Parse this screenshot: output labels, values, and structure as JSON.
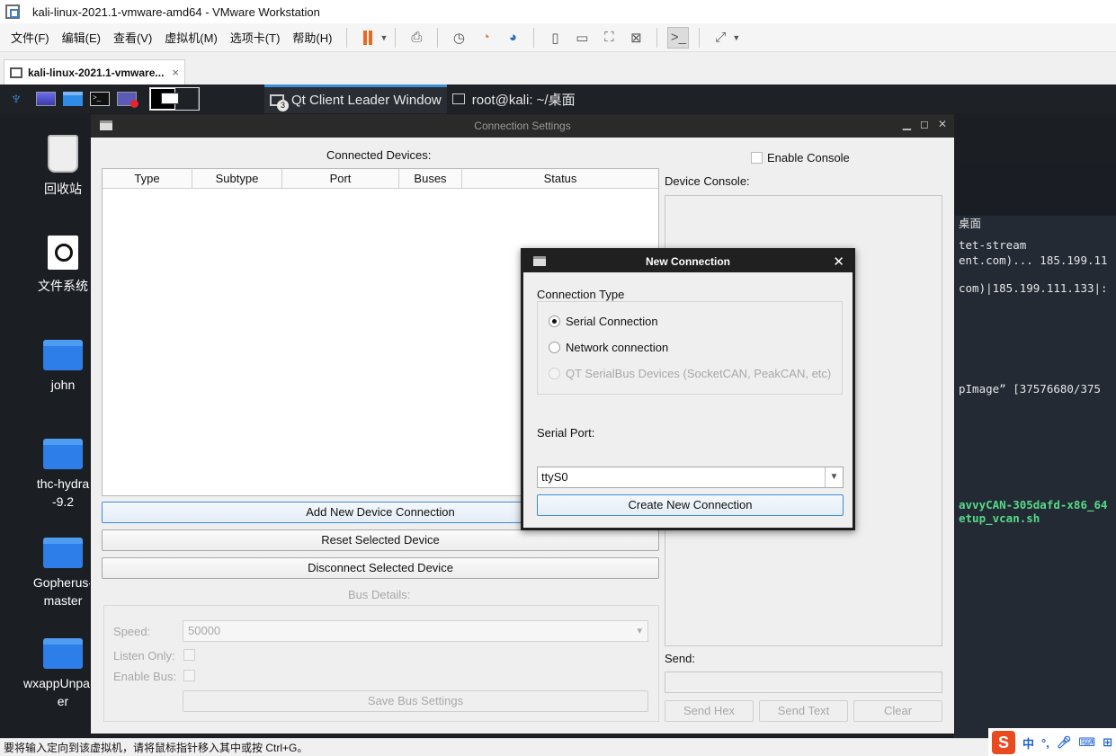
{
  "vmware": {
    "window_title": "kali-linux-2021.1-vmware-amd64 - VMware Workstation",
    "menu": [
      "文件(F)",
      "编辑(E)",
      "查看(V)",
      "虚拟机(M)",
      "选项卡(T)",
      "帮助(H)"
    ],
    "tab_label": "kali-linux-2021.1-vmware...",
    "tab_close": "×",
    "status_message": "要将输入定向到该虚拟机，请将鼠标指针移入其中或按 Ctrl+G。",
    "tray": {
      "ime_logo": "S",
      "ime_lang": "中",
      "punct": "°,"
    }
  },
  "kali": {
    "taskbar": {
      "active_window": "Qt Client Leader Window",
      "active_badge": "3",
      "terminal_window": "root@kali: ~/桌面"
    },
    "desktop_icons": [
      "回收站",
      "文件系统",
      "john",
      "thc-hydra-9.2",
      "Gopherus-master",
      "wxappUnpacker"
    ],
    "terminal_lines": [
      "桌面",
      "tet-stream",
      "ent.com)... 185.199.11",
      "com)|185.199.111.133|:",
      "pImage” [37576680/375",
      "avvyCAN-305dafd-x86_64",
      "etup_vcan.sh"
    ]
  },
  "connection_settings": {
    "title": "Connection Settings",
    "connected_devices_label": "Connected Devices:",
    "table_headers": [
      "Type",
      "Subtype",
      "Port",
      "Buses",
      "Status"
    ],
    "enable_console_label": "Enable Console",
    "device_console_label": "Device Console:",
    "add_button": "Add New Device Connection",
    "reset_button": "Reset Selected Device",
    "disconnect_button": "Disconnect Selected Device",
    "bus_details_label": "Bus Details:",
    "speed_label": "Speed:",
    "speed_value": "50000",
    "listen_only_label": "Listen Only:",
    "enable_bus_label": "Enable Bus:",
    "save_bus_button": "Save Bus Settings",
    "send_label": "Send:",
    "send_hex_button": "Send Hex",
    "send_text_button": "Send Text",
    "clear_button": "Clear"
  },
  "new_connection": {
    "title": "New Connection",
    "connection_type_label": "Connection Type",
    "options": [
      "Serial Connection",
      "Network connection",
      "QT SerialBus Devices (SocketCAN, PeakCAN, etc)"
    ],
    "selected_option": "Serial Connection",
    "serial_port_label": "Serial Port:",
    "serial_port_value": "ttyS0",
    "create_button": "Create New Connection"
  }
}
